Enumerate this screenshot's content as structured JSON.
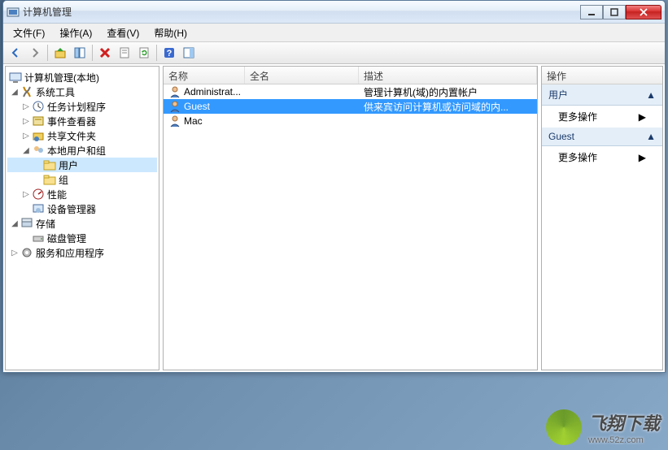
{
  "window": {
    "title": "计算机管理"
  },
  "menus": {
    "file": "文件(F)",
    "action": "操作(A)",
    "view": "查看(V)",
    "help": "帮助(H)"
  },
  "tree": {
    "root": "计算机管理(本地)",
    "system_tools": "系统工具",
    "task_scheduler": "任务计划程序",
    "event_viewer": "事件查看器",
    "shared_folders": "共享文件夹",
    "local_users": "本地用户和组",
    "users": "用户",
    "groups": "组",
    "performance": "性能",
    "device_manager": "设备管理器",
    "storage": "存储",
    "disk_mgmt": "磁盘管理",
    "services_apps": "服务和应用程序"
  },
  "list": {
    "headers": {
      "name": "名称",
      "fullname": "全名",
      "desc": "描述"
    },
    "rows": [
      {
        "name": "Administrat...",
        "fullname": "",
        "desc": "管理计算机(域)的内置帐户",
        "selected": false
      },
      {
        "name": "Guest",
        "fullname": "",
        "desc": "供来宾访问计算机或访问域的内...",
        "selected": true
      },
      {
        "name": "Mac",
        "fullname": "",
        "desc": "",
        "selected": false
      }
    ]
  },
  "actions": {
    "header": "操作",
    "section1": "用户",
    "more1": "更多操作",
    "section2": "Guest",
    "more2": "更多操作"
  },
  "watermark": {
    "brand": "飞翔下载",
    "url": "www.52z.com"
  }
}
